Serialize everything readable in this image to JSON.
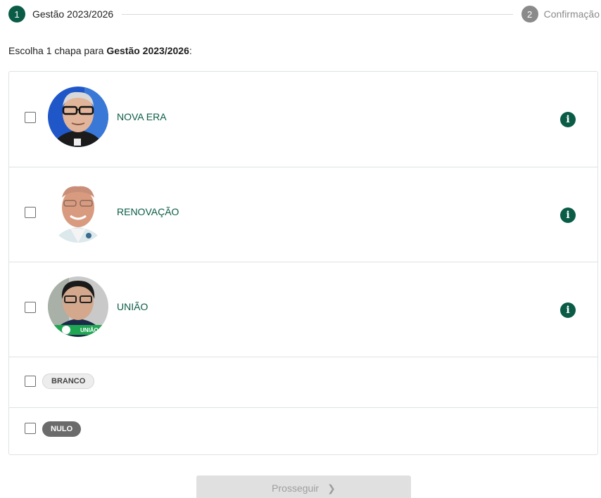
{
  "stepper": {
    "steps": [
      {
        "number": "1",
        "label": "Gestão 2023/2026"
      },
      {
        "number": "2",
        "label": "Confirmação"
      }
    ]
  },
  "prompt": {
    "prefix": "Escolha 1 chapa para ",
    "election": "Gestão 2023/2026",
    "suffix": ":"
  },
  "slates": [
    {
      "name": "NOVA ERA",
      "icon": "info-icon"
    },
    {
      "name": "RENOVAÇÃO",
      "icon": "info-icon"
    },
    {
      "name": "UNIÃO",
      "icon": "info-icon"
    }
  ],
  "special_options": [
    {
      "label": "BRANCO"
    },
    {
      "label": "NULO"
    }
  ],
  "info_glyph": "i",
  "uniao_badge": "UNIÃO",
  "proceed_button": {
    "label": "Prosseguir",
    "icon": "chevron-right-icon",
    "glyph": "❯"
  },
  "colors": {
    "accent": "#0a5c46",
    "inactive_step": "#8a8a8a",
    "border": "#dde3e1",
    "disabled_button": "#e0e0e0"
  }
}
